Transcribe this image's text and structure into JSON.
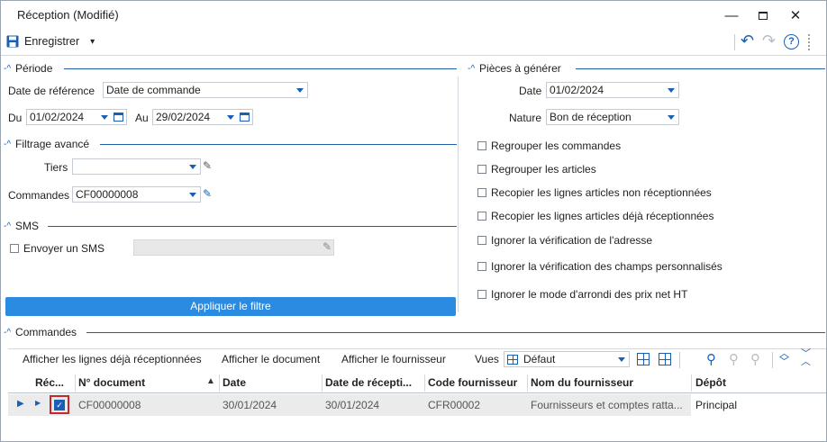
{
  "window": {
    "title": "Réception (Modifié)",
    "minimize_glyph": "—",
    "maximize_glyph": "☐",
    "close_glyph": "✕"
  },
  "toolbar": {
    "save_label": "Enregistrer",
    "save_icon": "floppy-disk-icon",
    "dropdown_glyph": "▾",
    "undo_glyph": "↶",
    "redo_glyph": "↷",
    "help_glyph": "?",
    "accent": "#1a5fb4"
  },
  "periode": {
    "title": "Période",
    "date_ref_label": "Date de référence",
    "date_ref_value": "Date de commande",
    "du_label": "Du",
    "du_value": "01/02/2024",
    "au_label": "Au",
    "au_value": "29/02/2024"
  },
  "filtrage": {
    "title": "Filtrage avancé",
    "tiers_label": "Tiers",
    "tiers_value": "",
    "commandes_label": "Commandes",
    "commandes_value": "CF00000008"
  },
  "sms": {
    "title": "SMS",
    "envoyer_label": "Envoyer un SMS",
    "sms_value": ""
  },
  "apply_button": "Appliquer le filtre",
  "pieces": {
    "title": "Pièces à générer",
    "date_label": "Date",
    "date_value": "01/02/2024",
    "nature_label": "Nature",
    "nature_value": "Bon de réception",
    "options": [
      "Regrouper les commandes",
      "Regrouper les articles",
      "Recopier les lignes articles non réceptionnées",
      "Recopier les lignes articles déjà réceptionnées",
      "Ignorer la vérification de l'adresse",
      "Ignorer la vérification des champs personnalisés",
      "Ignorer le mode d'arrondi des prix net HT"
    ]
  },
  "commandes_section": {
    "title": "Commandes",
    "actions": [
      "Afficher les lignes déjà réceptionnées",
      "Afficher le document",
      "Afficher le fournisseur"
    ],
    "vues_label": "Vues",
    "vues_value": "Défaut",
    "columns": [
      "Réc...",
      "N° document",
      "Date",
      "Date de récepti...",
      "Code fournisseur",
      "Nom du fournisseur",
      "Dépôt"
    ],
    "rows": [
      {
        "received": true,
        "document": "CF00000008",
        "date": "30/01/2024",
        "date_reception": "30/01/2024",
        "code_fournisseur": "CFR00002",
        "nom_fournisseur": "Fournisseurs et comptes ratta...",
        "depot": "Principal"
      }
    ]
  }
}
